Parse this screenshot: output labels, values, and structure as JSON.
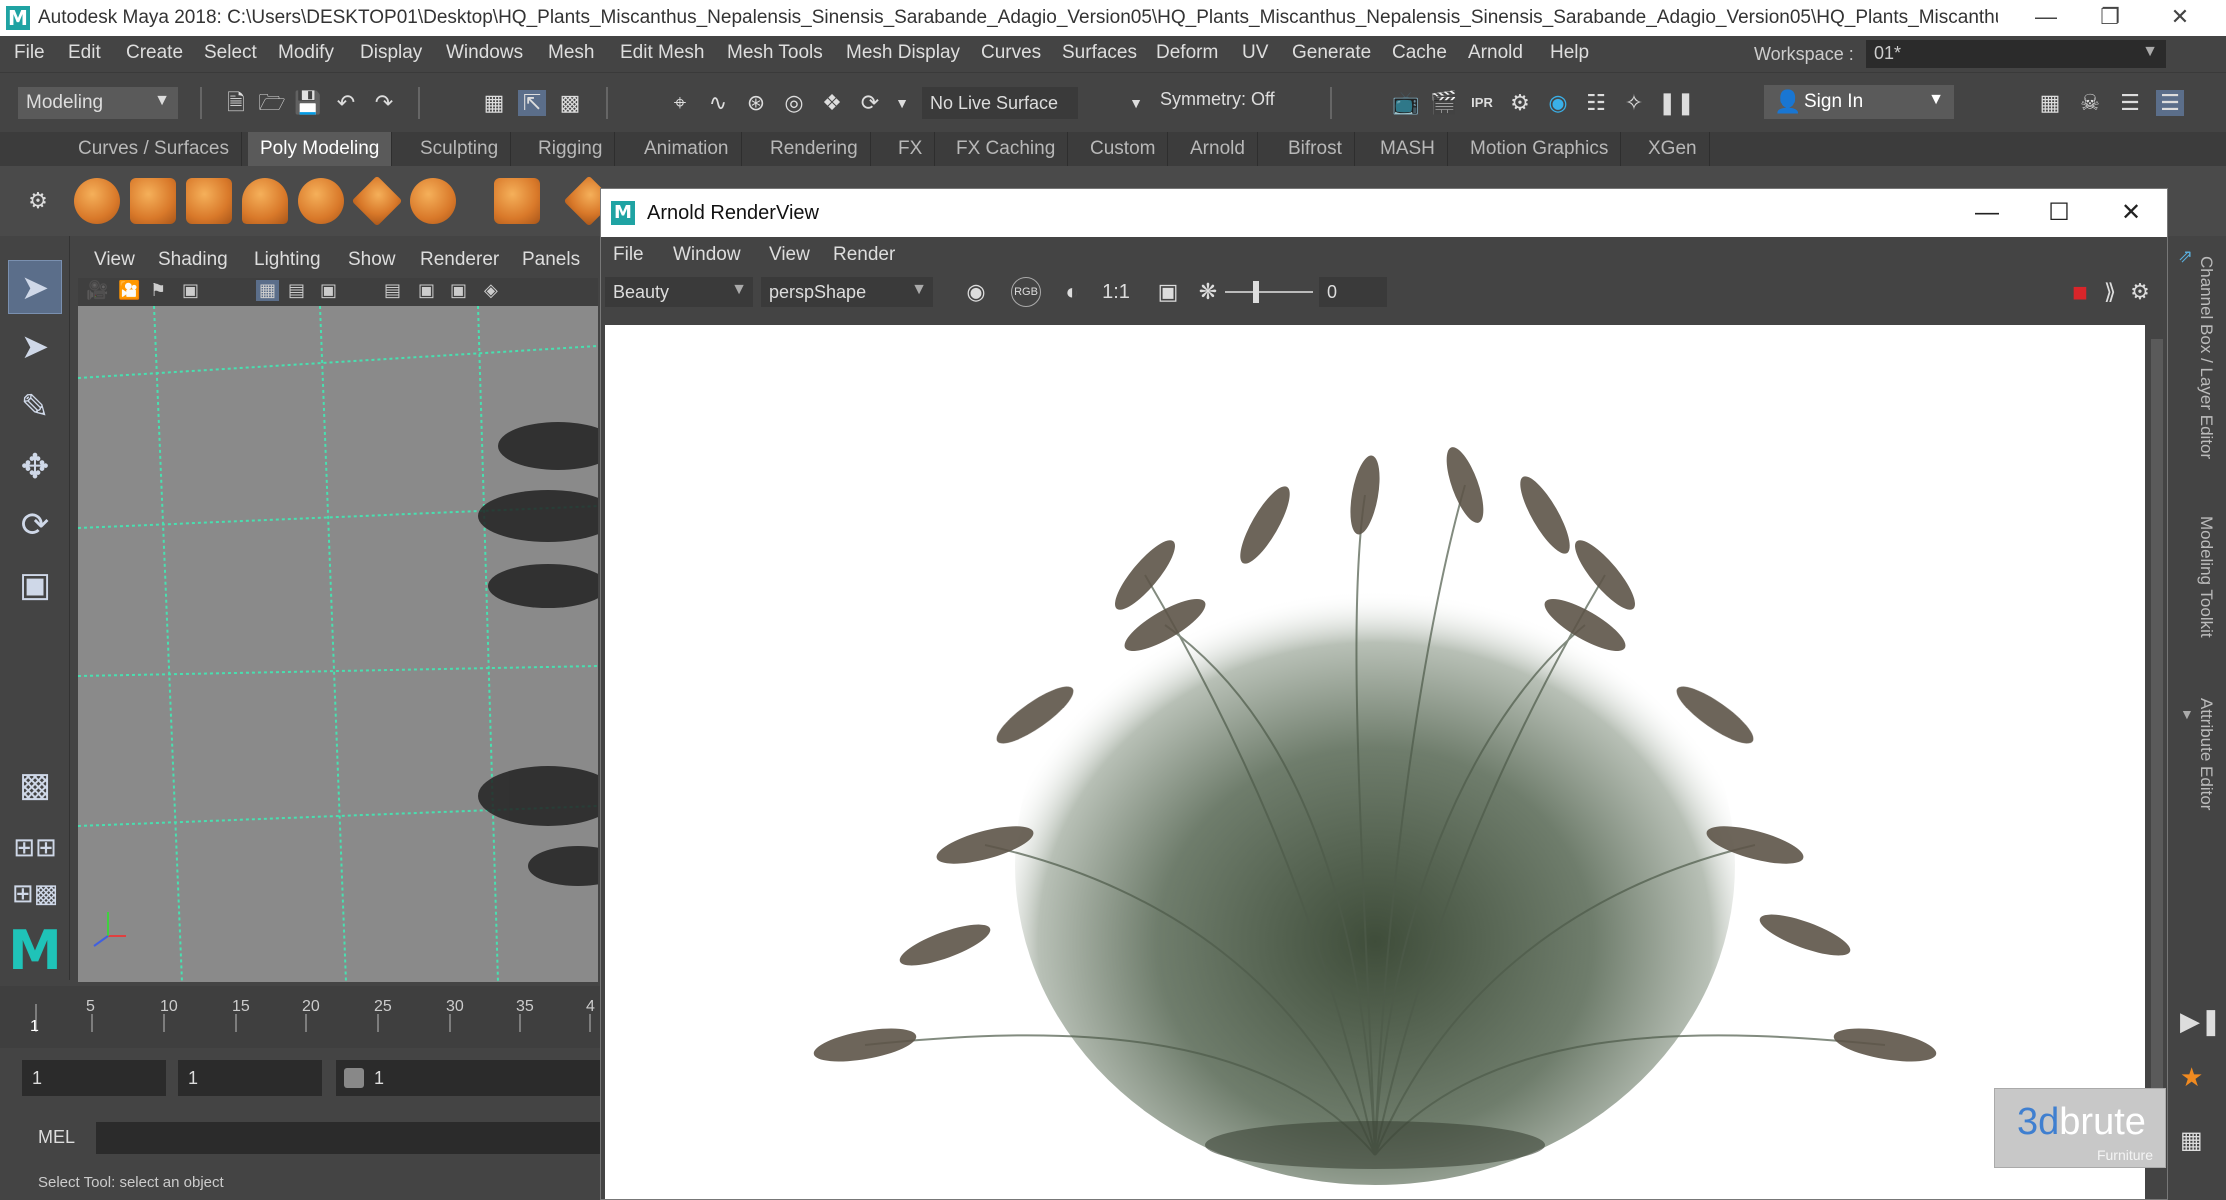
{
  "window": {
    "title": "Autodesk Maya 2018: C:\\Users\\DESKTOP01\\Desktop\\HQ_Plants_Miscanthus_Nepalensis_Sinensis_Sarabande_Adagio_Version05\\HQ_Plants_Miscanthus_Nepalensis_Sinensis_Sarabande_Adagio_Version05\\HQ_Plants_Miscanthus_...",
    "app_icon": "M"
  },
  "menubar": {
    "items": [
      "File",
      "Edit",
      "Create",
      "Select",
      "Modify",
      "Display",
      "Windows",
      "Mesh",
      "Edit Mesh",
      "Mesh Tools",
      "Mesh Display",
      "Curves",
      "Surfaces",
      "Deform",
      "UV",
      "Generate",
      "Cache",
      "Arnold",
      "Help"
    ],
    "workspace_label": "Workspace :",
    "workspace_value": "01*"
  },
  "statusline": {
    "mode": "Modeling",
    "live_surface": "No Live Surface",
    "symmetry": "Symmetry: Off",
    "sign_in": "Sign In"
  },
  "shelf": {
    "tabs": [
      "Curves / Surfaces",
      "Poly Modeling",
      "Sculpting",
      "Rigging",
      "Animation",
      "Rendering",
      "FX",
      "FX Caching",
      "Custom",
      "Arnold",
      "Bifrost",
      "MASH",
      "Motion Graphics",
      "XGen"
    ],
    "active_tab": "Poly Modeling"
  },
  "viewport": {
    "menu": [
      "View",
      "Shading",
      "Lighting",
      "Show",
      "Renderer",
      "Panels"
    ]
  },
  "timeline": {
    "current_frame": "1",
    "ticks": [
      "5",
      "10",
      "15",
      "20",
      "25",
      "30",
      "35",
      "4"
    ],
    "range_start": "1",
    "range_inner_start": "1",
    "range_slider_value": "1"
  },
  "command_line": {
    "label": "MEL",
    "help_text": "Select Tool: select an object"
  },
  "right_panels": [
    "Channel Box / Layer Editor",
    "Modeling Toolkit",
    "Attribute Editor"
  ],
  "render_view": {
    "title": "Arnold RenderView",
    "menu": [
      "File",
      "Window",
      "View",
      "Render"
    ],
    "aov": "Beauty",
    "camera": "perspShape",
    "zoom": "1:1",
    "exposure_value": "0",
    "rgb_label": "RGB",
    "stop_color": "#d9252a"
  },
  "watermark": {
    "brand_number": "3d",
    "brand_word": "brute",
    "sub": "Furniture"
  }
}
